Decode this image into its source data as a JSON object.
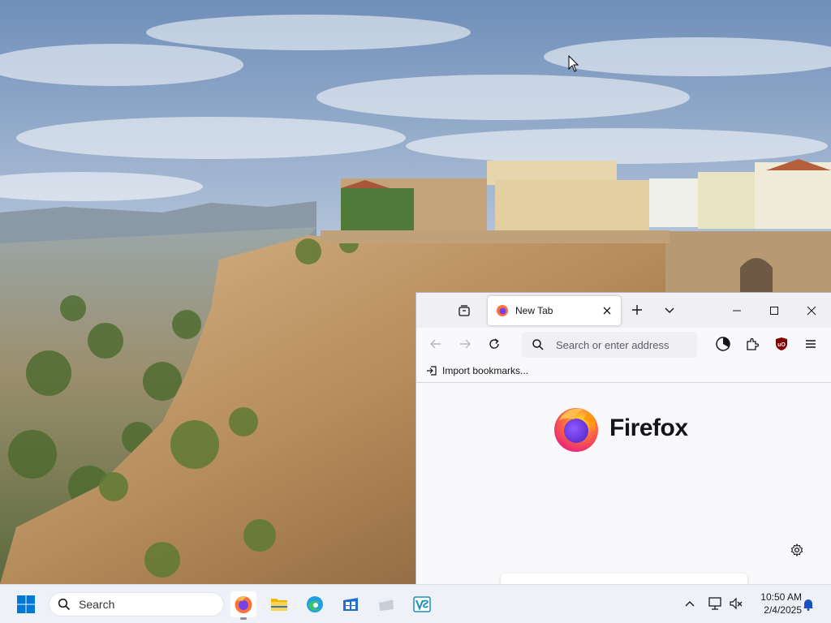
{
  "colors": {
    "accent_blue": "#0a84ff",
    "windows_blue": "#0078d4",
    "ublock_red": "#800000",
    "firefox_orange": "#ff7139",
    "firefox_purple": "#7542e5"
  },
  "desktop": {
    "wallpaper": "Ronda cliffside town under cloudy sky"
  },
  "firefox": {
    "tab_list_icon": "tab-list-icon",
    "tabs": [
      {
        "title": "New Tab",
        "icon": "firefox-favicon",
        "active": true
      }
    ],
    "new_tab_icon": "plus-icon",
    "all_tabs_icon": "chevron-down-icon",
    "window_controls": [
      "minimize-icon",
      "maximize-icon",
      "close-icon"
    ],
    "nav": {
      "back_icon": "back-arrow-icon",
      "forward_icon": "forward-arrow-icon",
      "reload_icon": "reload-icon"
    },
    "urlbar": {
      "placeholder": "Search or enter address",
      "value": ""
    },
    "toolbar_icons": [
      "account-icon",
      "extensions-icon",
      "ublock-origin-icon",
      "hamburger-menu-icon"
    ],
    "bookmarks_bar": {
      "import_label": "Import bookmarks..."
    },
    "newtab_page": {
      "brand_name": "Firefox",
      "settings_icon": "gear-icon"
    }
  },
  "taskbar": {
    "start_icon": "windows-start-icon",
    "search_label": "Search",
    "apps": [
      {
        "name": "Firefox",
        "icon": "firefox-icon",
        "active": true
      },
      {
        "name": "File Explorer",
        "icon": "folder-icon",
        "active": false
      },
      {
        "name": "Microsoft Edge",
        "icon": "edge-icon",
        "active": false
      },
      {
        "name": "Microsoft Store",
        "icon": "store-icon",
        "active": false
      },
      {
        "name": "App",
        "icon": "generic-app-icon",
        "active": false
      },
      {
        "name": "Visual Studio",
        "icon": "visual-studio-icon",
        "active": false
      }
    ],
    "tray": {
      "time": "10:50 AM",
      "date": "2/4/2025"
    }
  }
}
